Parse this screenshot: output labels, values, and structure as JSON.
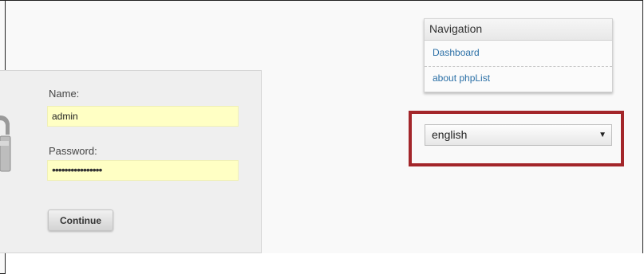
{
  "login": {
    "name_label": "Name:",
    "name_value": "admin",
    "password_label": "Password:",
    "password_value": "••••••••••••••••",
    "continue_label": "Continue"
  },
  "navigation": {
    "title": "Navigation",
    "items": [
      {
        "label": "Dashboard"
      },
      {
        "label": "about phpList"
      }
    ]
  },
  "language": {
    "selected": "english",
    "arrow": "▼"
  },
  "colors": {
    "highlight": "#a3262a",
    "input_bg": "#ffffc4",
    "link": "#2a6fa6"
  },
  "icons": {
    "lock": "lock-icon",
    "select_arrow": "chevron-down-icon"
  }
}
